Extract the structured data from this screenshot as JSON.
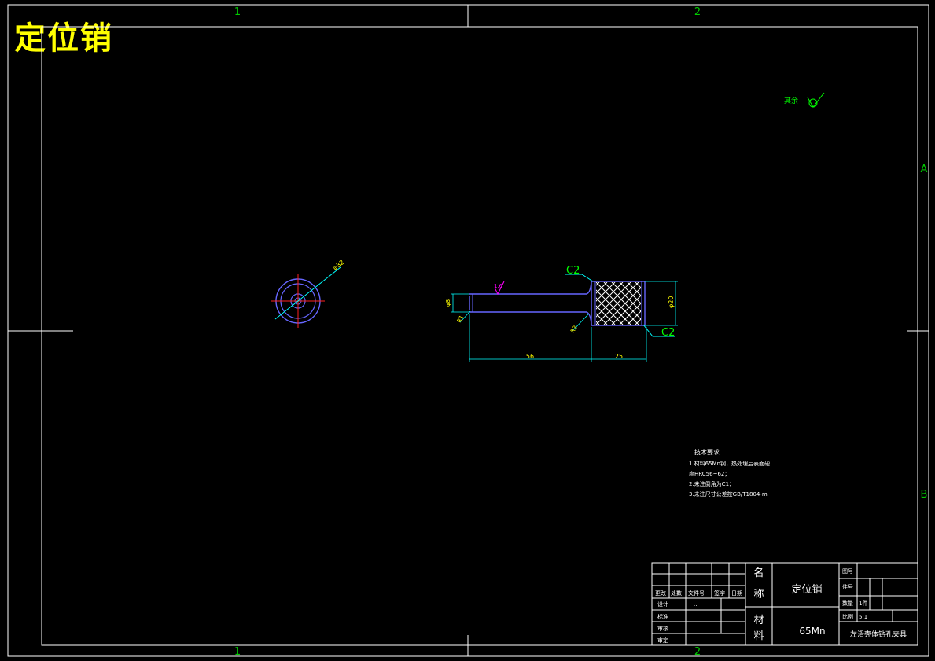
{
  "drawing_title": "定位销",
  "zone_labels": {
    "col1_top": "1",
    "col2_top": "2",
    "col1_bottom": "1",
    "col2_bottom": "2",
    "row_a": "A",
    "row_b": "B"
  },
  "roughness_mark": "其余",
  "end_view": {
    "diameter_label": "φ32"
  },
  "side_view": {
    "chamfer_left_top": "C2",
    "chamfer_right": "C2",
    "roughness_value": "1.6",
    "dim_shaft_dia": "φ8",
    "dim_tip_chamfer": "R1",
    "dim_fillet": "R3",
    "dim_head_dia": "φ20",
    "dim_length_shaft": "56",
    "dim_length_head": "25"
  },
  "notes": {
    "title": "技术要求",
    "lines": [
      "1.材料65Mn钢，热处理后表面硬",
      "度HRC56~62；",
      "2.未注倒角为C1；",
      "3.未注尺寸公差按GB/T1804-m"
    ]
  },
  "title_block": {
    "change_headers": [
      "更改",
      "处数",
      "文件号",
      "签字",
      "日期"
    ],
    "roles": [
      "设计",
      "标准",
      "审核",
      "审定"
    ],
    "designer_value": "..",
    "name_label": [
      "名",
      "称"
    ],
    "name_value": "定位销",
    "material_label": [
      "材",
      "料"
    ],
    "material_value": "65Mn",
    "drawing_no_label": "图号",
    "pieces_label": "件号",
    "quantity_label": "数量",
    "quantity_value": "1件",
    "scale_label": "比例",
    "scale_value": "5:1",
    "project_name": "左滑壳体钻孔夹具"
  }
}
